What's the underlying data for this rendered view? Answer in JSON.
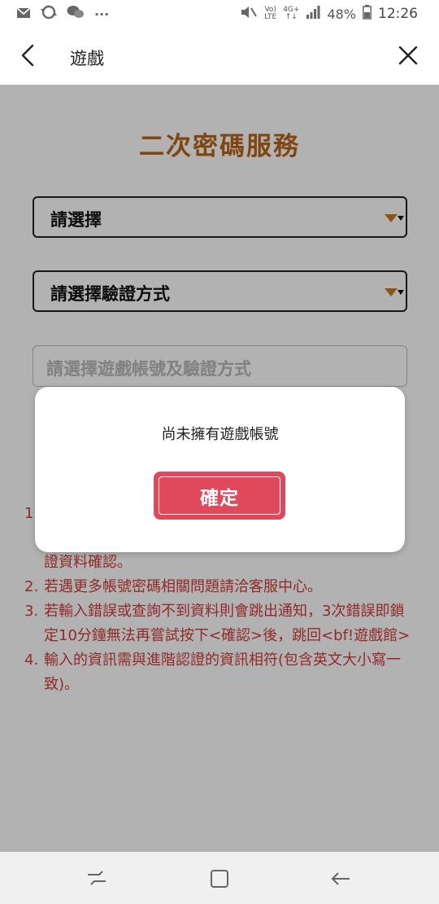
{
  "status_bar": {
    "time": "12:26",
    "battery": "48%",
    "volte_top": "Vo)",
    "volte_bottom": "LTE",
    "network": "4G+",
    "more": "···"
  },
  "titlebar": {
    "title": "遊戲"
  },
  "main": {
    "heading": "二次密碼服務",
    "select_game": "請選擇",
    "select_method": "請選擇驗證方式",
    "input_placeholder": "請選擇遊戲帳號及驗證方式",
    "notes": [
      {
        "num": "1.",
        "text": "證資料確認。"
      },
      {
        "num": "2.",
        "text": "若遇更多帳號密碼相關問題請洽客服中心。"
      },
      {
        "num": "3.",
        "text": "若輸入錯誤或查詢不到資料則會跳出通知，3次錯誤即鎖定10分鐘無法再嘗試按下<確認>後，跳回<bf!遊戲館>"
      },
      {
        "num": "4.",
        "text": "輸入的資訊需與進階認證的資訊相符(包含英文大小寫一致)。"
      }
    ]
  },
  "dialog": {
    "message": "尚未擁有遊戲帳號",
    "confirm_label": "確定"
  },
  "colors": {
    "heading": "#b8651a",
    "notes": "#d23b3b",
    "confirm_button": "#e0485c",
    "caret": "#c87a1e"
  },
  "icons": [
    "mail-icon",
    "sync-icon",
    "wechat-icon",
    "mute-icon",
    "signal-icon",
    "battery-icon",
    "back-arrow-icon",
    "close-icon",
    "recent-apps-icon",
    "home-icon",
    "nav-back-icon"
  ]
}
